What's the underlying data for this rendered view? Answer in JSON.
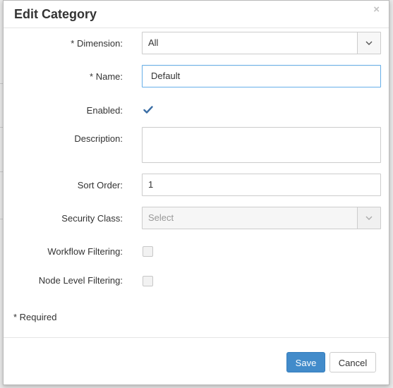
{
  "dialog": {
    "title": "Edit Category",
    "close_glyph": "×"
  },
  "form": {
    "dimension": {
      "label": "* Dimension:",
      "value": "All"
    },
    "name": {
      "label": "* Name:",
      "value": "Default"
    },
    "enabled": {
      "label": "Enabled:",
      "checked": true
    },
    "description": {
      "label": "Description:",
      "value": ""
    },
    "sort_order": {
      "label": "Sort Order:",
      "value": "1"
    },
    "security_class": {
      "label": "Security Class:",
      "placeholder": "Select",
      "disabled": true
    },
    "workflow_filtering": {
      "label": "Workflow Filtering:",
      "checked": false
    },
    "node_level_filtering": {
      "label": "Node Level Filtering:",
      "checked": false
    }
  },
  "required_note": "* Required",
  "footer": {
    "save_label": "Save",
    "cancel_label": "Cancel"
  },
  "colors": {
    "primary": "#428bca",
    "checkmark": "#3b6ea5",
    "focus_border": "#66afe9"
  },
  "icons": {
    "close": "close-icon",
    "dropdown": "chevron-down-icon",
    "check": "checkmark-icon"
  }
}
